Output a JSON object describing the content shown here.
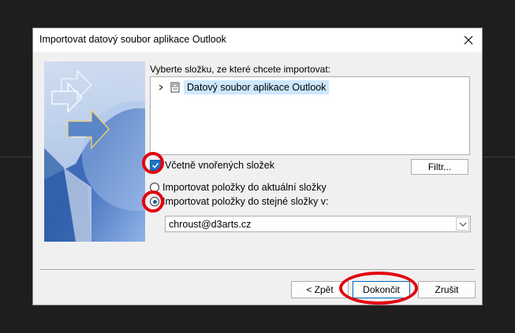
{
  "dialog": {
    "title": "Importovat datový soubor aplikace Outlook",
    "close_icon": "close-icon"
  },
  "folder_prompt": "Vyberte složku, ze které chcete importovat:",
  "tree": {
    "items": [
      {
        "label": "Datový soubor aplikace Outlook",
        "icon": "data-file-icon",
        "expanded": false,
        "selected": true
      }
    ]
  },
  "include_subfolders": {
    "label": "Včetně vnořených složek",
    "checked": true
  },
  "filter_button": "Filtr...",
  "import_options": [
    {
      "label": "Importovat položky do aktuální složky",
      "checked": false
    },
    {
      "label": "Importovat položky do stejné složky v:",
      "checked": true
    }
  ],
  "target_account": {
    "value": "chroust@d3arts.cz"
  },
  "buttons": {
    "back": "< Zpět",
    "finish": "Dokončit",
    "cancel": "Zrušit"
  },
  "colors": {
    "annotation": "#e3000f",
    "selection": "#cce8ff",
    "accent": "#1a73c9"
  }
}
